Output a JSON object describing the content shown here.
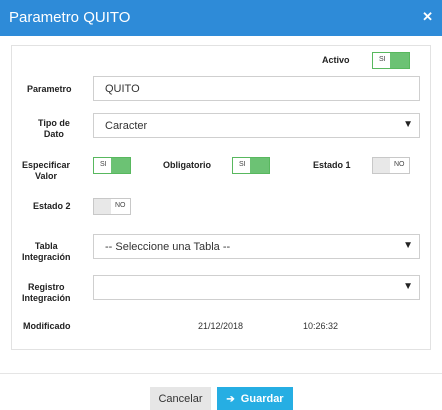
{
  "dialog": {
    "title": "Parametro QUITO",
    "close_icon": "close-icon"
  },
  "activo": {
    "label": "Activo",
    "toggle": {
      "state": "on",
      "text": "SI"
    }
  },
  "parametro": {
    "label": "Parametro",
    "value": "QUITO"
  },
  "tipo_dato": {
    "label_line1": "Tipo de",
    "label_line2": "Dato",
    "selected": "Caracter"
  },
  "especificar_valor": {
    "label_line1": "Especificar",
    "label_line2": "Valor",
    "toggle": {
      "state": "on",
      "text": "SI"
    }
  },
  "obligatorio": {
    "label": "Obligatorio",
    "toggle": {
      "state": "on",
      "text": "SI"
    }
  },
  "estado1": {
    "label": "Estado 1",
    "toggle": {
      "state": "off",
      "text": "NO"
    }
  },
  "estado2": {
    "label": "Estado 2",
    "toggle": {
      "state": "off",
      "text": "NO"
    }
  },
  "tabla_integracion": {
    "label_line1": "Tabla",
    "label_line2": "Integración",
    "selected": "-- Seleccione una Tabla --"
  },
  "registro_integracion": {
    "label_line1": "Registro",
    "label_line2": "Integración",
    "selected": ""
  },
  "modificado": {
    "label": "Modificado",
    "date": "21/12/2018",
    "time": "10:26:32"
  },
  "footer": {
    "cancel_label": "Cancelar",
    "save_label": "Guardar",
    "save_icon": "save-sign-in-icon"
  },
  "colors": {
    "header": "#2e8bd8",
    "toggle_on": "#6cc274",
    "save_button": "#26aee3"
  }
}
